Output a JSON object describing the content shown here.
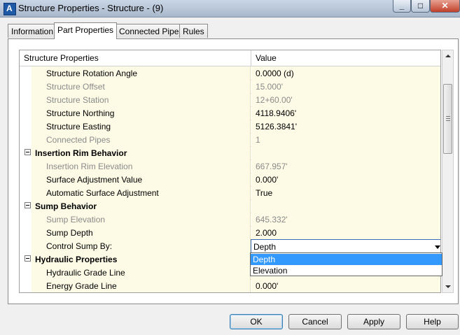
{
  "window": {
    "title": "Structure Properties - Structure - (9)",
    "icon": "autocad-civil-icon",
    "controls": {
      "minimize": "minimize-icon",
      "maximize": "maximize-icon",
      "close": "close-icon"
    }
  },
  "tabs": [
    {
      "label": "Information",
      "active": false
    },
    {
      "label": "Part Properties",
      "active": true
    },
    {
      "label": "Connected Pipes",
      "active": false
    },
    {
      "label": "Rules",
      "active": false
    }
  ],
  "grid": {
    "col_name": "Structure Properties",
    "col_value": "Value",
    "rows": [
      {
        "type": "prop",
        "name": "Structure Rotation Angle",
        "value": "0.0000 (d)",
        "enabled": true
      },
      {
        "type": "prop",
        "name": "Structure Offset",
        "value": "15.000'",
        "enabled": false
      },
      {
        "type": "prop",
        "name": "Structure Station",
        "value": "12+60.00'",
        "enabled": false
      },
      {
        "type": "prop",
        "name": "Structure Northing",
        "value": "4118.9406'",
        "enabled": true
      },
      {
        "type": "prop",
        "name": "Structure Easting",
        "value": "5126.3841'",
        "enabled": true
      },
      {
        "type": "prop",
        "name": "Connected Pipes",
        "value": "1",
        "enabled": false
      },
      {
        "type": "category",
        "name": "Insertion Rim Behavior",
        "value": ""
      },
      {
        "type": "prop",
        "name": "Insertion Rim Elevation",
        "value": "667.957'",
        "enabled": false
      },
      {
        "type": "prop",
        "name": "Surface Adjustment Value",
        "value": "0.000'",
        "enabled": true
      },
      {
        "type": "prop",
        "name": "Automatic Surface Adjustment",
        "value": "True",
        "enabled": true
      },
      {
        "type": "category",
        "name": "Sump Behavior",
        "value": ""
      },
      {
        "type": "prop",
        "name": "Sump Elevation",
        "value": "645.332'",
        "enabled": false
      },
      {
        "type": "prop",
        "name": "Sump Depth",
        "value": "2.000",
        "enabled": true
      },
      {
        "type": "combo",
        "name": "Control Sump By:",
        "value": "Depth",
        "enabled": true
      },
      {
        "type": "category",
        "name": "Hydraulic Properties",
        "value": ""
      },
      {
        "type": "prop",
        "name": "Hydraulic Grade Line",
        "value": "",
        "enabled": true
      },
      {
        "type": "prop",
        "name": "Energy Grade Line",
        "value": "0.000'",
        "enabled": true
      }
    ]
  },
  "dropdown": {
    "options": [
      "Depth",
      "Elevation"
    ],
    "selected": "Depth"
  },
  "buttons": {
    "ok": "OK",
    "cancel": "Cancel",
    "apply": "Apply",
    "help": "Help"
  },
  "colors": {
    "row_background": "#fdfbe6",
    "disabled_text": "#8a8a8a",
    "selection": "#3399ff"
  }
}
